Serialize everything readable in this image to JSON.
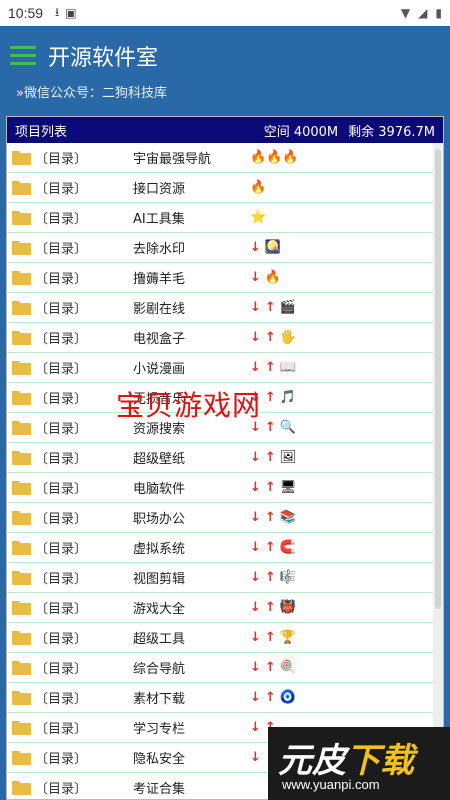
{
  "status": {
    "time": "10:59",
    "download_icon": "download-icon",
    "a_icon": "A-icon",
    "wifi_icon": "wifi-icon",
    "battery_icon": "battery-icon"
  },
  "app": {
    "title": "开源软件室",
    "subtitle": "»微信公众号：二狗科技库"
  },
  "panel": {
    "label": "项目列表",
    "space": "空间 4000M",
    "remaining": "剩余 3976.7M"
  },
  "items": [
    {
      "tag": "〔目录〕",
      "name": "宇宙最强导航",
      "icons": "🔥🔥🔥"
    },
    {
      "tag": "〔目录〕",
      "name": "接口资源",
      "icons": "🔥"
    },
    {
      "tag": "〔目录〕",
      "name": "AI工具集",
      "icons": "⭐"
    },
    {
      "tag": "〔目录〕",
      "name": "去除水印",
      "icons": "↓ 🎑"
    },
    {
      "tag": "〔目录〕",
      "name": "撸薅羊毛",
      "icons": "↓ 🔥"
    },
    {
      "tag": "〔目录〕",
      "name": "影剧在线",
      "icons": "↓ ↑ 🎬"
    },
    {
      "tag": "〔目录〕",
      "name": "电视盒子",
      "icons": "↓ ↑ 🖐"
    },
    {
      "tag": "〔目录〕",
      "name": "小说漫画",
      "icons": "↓ ↑ 📖"
    },
    {
      "tag": "〔目录〕",
      "name": "无损音乐",
      "icons": "↓ ↑ 🎵"
    },
    {
      "tag": "〔目录〕",
      "name": "资源搜索",
      "icons": "↓ ↑ 🔍"
    },
    {
      "tag": "〔目录〕",
      "name": "超级壁纸",
      "icons": "↓ ↑ 🖼"
    },
    {
      "tag": "〔目录〕",
      "name": "电脑软件",
      "icons": "↓ ↑ 🖥"
    },
    {
      "tag": "〔目录〕",
      "name": "职场办公",
      "icons": "↓ ↑ 📚"
    },
    {
      "tag": "〔目录〕",
      "name": "虚拟系统",
      "icons": "↓ ↑ 🧲"
    },
    {
      "tag": "〔目录〕",
      "name": "视图剪辑",
      "icons": "↓ ↑ 🎼"
    },
    {
      "tag": "〔目录〕",
      "name": "游戏大全",
      "icons": "↓ ↑ 👹"
    },
    {
      "tag": "〔目录〕",
      "name": "超级工具",
      "icons": "↓ ↑ 🏆"
    },
    {
      "tag": "〔目录〕",
      "name": "综合导航",
      "icons": "↓ ↑ 🍭"
    },
    {
      "tag": "〔目录〕",
      "name": "素材下载",
      "icons": "↓ ↑ 🧿"
    },
    {
      "tag": "〔目录〕",
      "name": "学习专栏",
      "icons": "↓ ↑"
    },
    {
      "tag": "〔目录〕",
      "name": "隐私安全",
      "icons": "↓"
    },
    {
      "tag": "〔目录〕",
      "name": "考证合集",
      "icons": ""
    }
  ],
  "watermark": "宝贝游戏网",
  "site_logo": {
    "text_white": "元皮",
    "text_yellow": "下载",
    "url": "www.yuanpi.com"
  }
}
